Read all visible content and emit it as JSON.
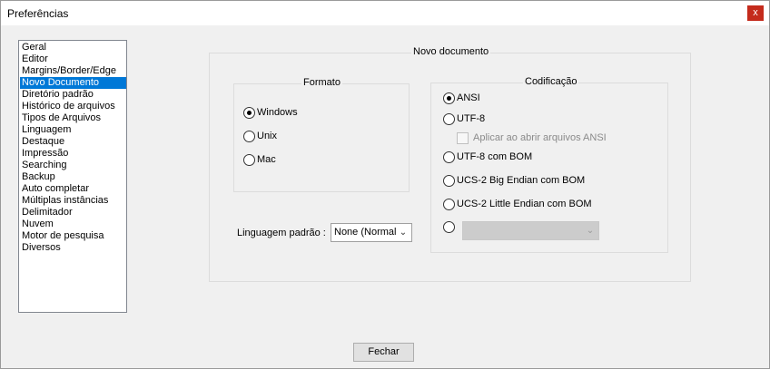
{
  "window": {
    "title": "Preferências",
    "close_glyph": "x"
  },
  "sidebar": {
    "items": [
      {
        "label": "Geral"
      },
      {
        "label": "Editor"
      },
      {
        "label": "Margins/Border/Edge"
      },
      {
        "label": "Novo Documento",
        "selected": true
      },
      {
        "label": "Diretório padrão"
      },
      {
        "label": "Histórico de arquivos"
      },
      {
        "label": "Tipos de Arquivos"
      },
      {
        "label": "Linguagem"
      },
      {
        "label": "Destaque"
      },
      {
        "label": "Impressão"
      },
      {
        "label": "Searching"
      },
      {
        "label": "Backup"
      },
      {
        "label": "Auto completar"
      },
      {
        "label": "Múltiplas instâncias"
      },
      {
        "label": "Delimitador"
      },
      {
        "label": "Nuvem"
      },
      {
        "label": "Motor de pesquisa"
      },
      {
        "label": "Diversos"
      }
    ]
  },
  "new_document": {
    "title": "Novo documento",
    "format": {
      "title": "Formato",
      "options": [
        {
          "label": "Windows",
          "checked": true
        },
        {
          "label": "Unix",
          "checked": false
        },
        {
          "label": "Mac",
          "checked": false
        }
      ]
    },
    "encoding": {
      "title": "Codificação",
      "options": [
        {
          "label": "ANSI",
          "checked": true
        },
        {
          "label": "UTF-8",
          "checked": false
        },
        {
          "label": "UTF-8 com BOM",
          "checked": false
        },
        {
          "label": "UCS-2 Big Endian com BOM",
          "checked": false
        },
        {
          "label": "UCS-2 Little Endian com BOM",
          "checked": false
        },
        {
          "label": "",
          "checked": false
        }
      ],
      "ansi_checkbox": {
        "label": "Aplicar ao abrir arquivos ANSI",
        "checked": false,
        "disabled": true
      },
      "other_select": {
        "value": "",
        "disabled": true
      }
    },
    "default_language": {
      "label": "Linguagem padrão :",
      "value": "None (Normal"
    }
  },
  "footer": {
    "close_label": "Fechar"
  },
  "colors": {
    "selection": "#0078d7",
    "close_button": "#c42b1c",
    "dialog_bg": "#f0f0f0"
  }
}
